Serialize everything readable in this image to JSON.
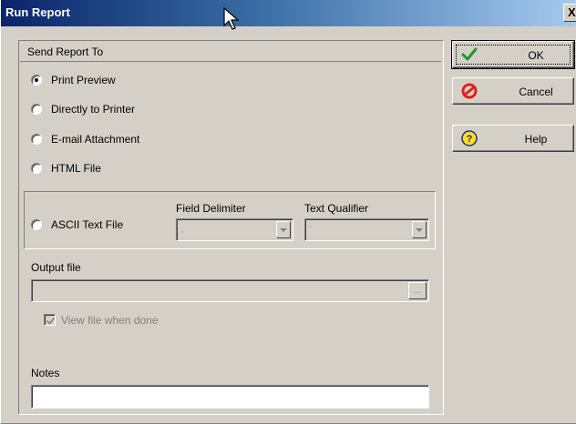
{
  "window": {
    "title": "Run Report",
    "close_label": "X"
  },
  "send_report": {
    "header": "Send Report To",
    "options": [
      {
        "label": "Print Preview",
        "selected": true
      },
      {
        "label": "Directly to Printer",
        "selected": false
      },
      {
        "label": "E-mail Attachment",
        "selected": false
      },
      {
        "label": "HTML File",
        "selected": false
      },
      {
        "label": "ASCII Text File",
        "selected": false
      }
    ]
  },
  "ascii": {
    "field_delimiter_label": "Field Delimiter",
    "field_delimiter_value": ",",
    "text_qualifier_label": "Text Qualifier",
    "text_qualifier_value": "'"
  },
  "output": {
    "label": "Output file",
    "value": "",
    "browse_label": "..."
  },
  "view_when_done": {
    "label": "View file when done",
    "checked": true
  },
  "notes": {
    "label": "Notes",
    "value": ""
  },
  "buttons": {
    "ok": "OK",
    "cancel": "Cancel",
    "help": "Help"
  },
  "icons": {
    "ok": "green-checkmark-icon",
    "cancel": "red-no-entry-icon",
    "help": "yellow-question-icon",
    "cursor": "mouse-pointer-icon"
  },
  "colors": {
    "titlebar_start": "#0a246a",
    "titlebar_end": "#a6caf0",
    "dialog_bg": "#d4d0c8"
  }
}
